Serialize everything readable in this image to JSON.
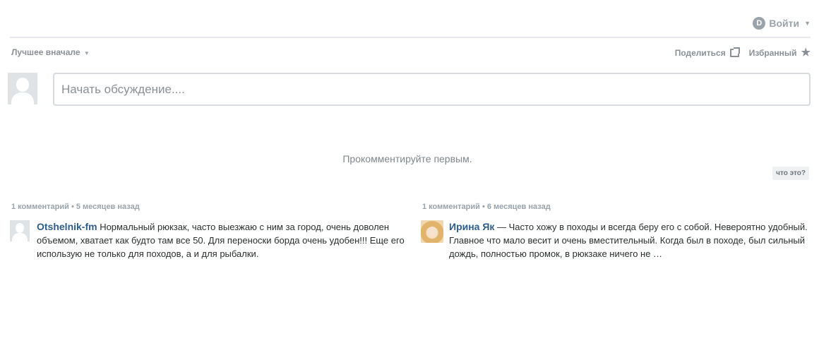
{
  "header": {
    "login_label": "Войти",
    "logo_letter": "D"
  },
  "toolbar": {
    "sort_label": "Лучшее вначале",
    "share_label": "Поделиться",
    "favorite_label": "Избранный"
  },
  "composer": {
    "placeholder": "Начать обсуждение...."
  },
  "empty_message": "Прокомментируйте первым.",
  "whats_this_label": "что это?",
  "recommendations": [
    {
      "meta": "1 комментарий • 5 месяцев назад",
      "author": "Otshelnik-fm",
      "text": " Нормальный рюкзак, часто выезжаю с ним за город, очень доволен объемом, хватает как будто там все 50. Для переноски борда очень удобен!!! Еще его использую не только для походов, а и для рыбалки."
    },
    {
      "meta": "1 комментарий • 6 месяцев назад",
      "author": "Ирина Як",
      "text": "  — Часто хожу в походы и всегда беру его с собой. Невероятно удобный. Главное что мало весит и очень вместительный. Когда был в походе, был сильный дождь, полностью промок, в рюкзаке ничего не …"
    }
  ]
}
